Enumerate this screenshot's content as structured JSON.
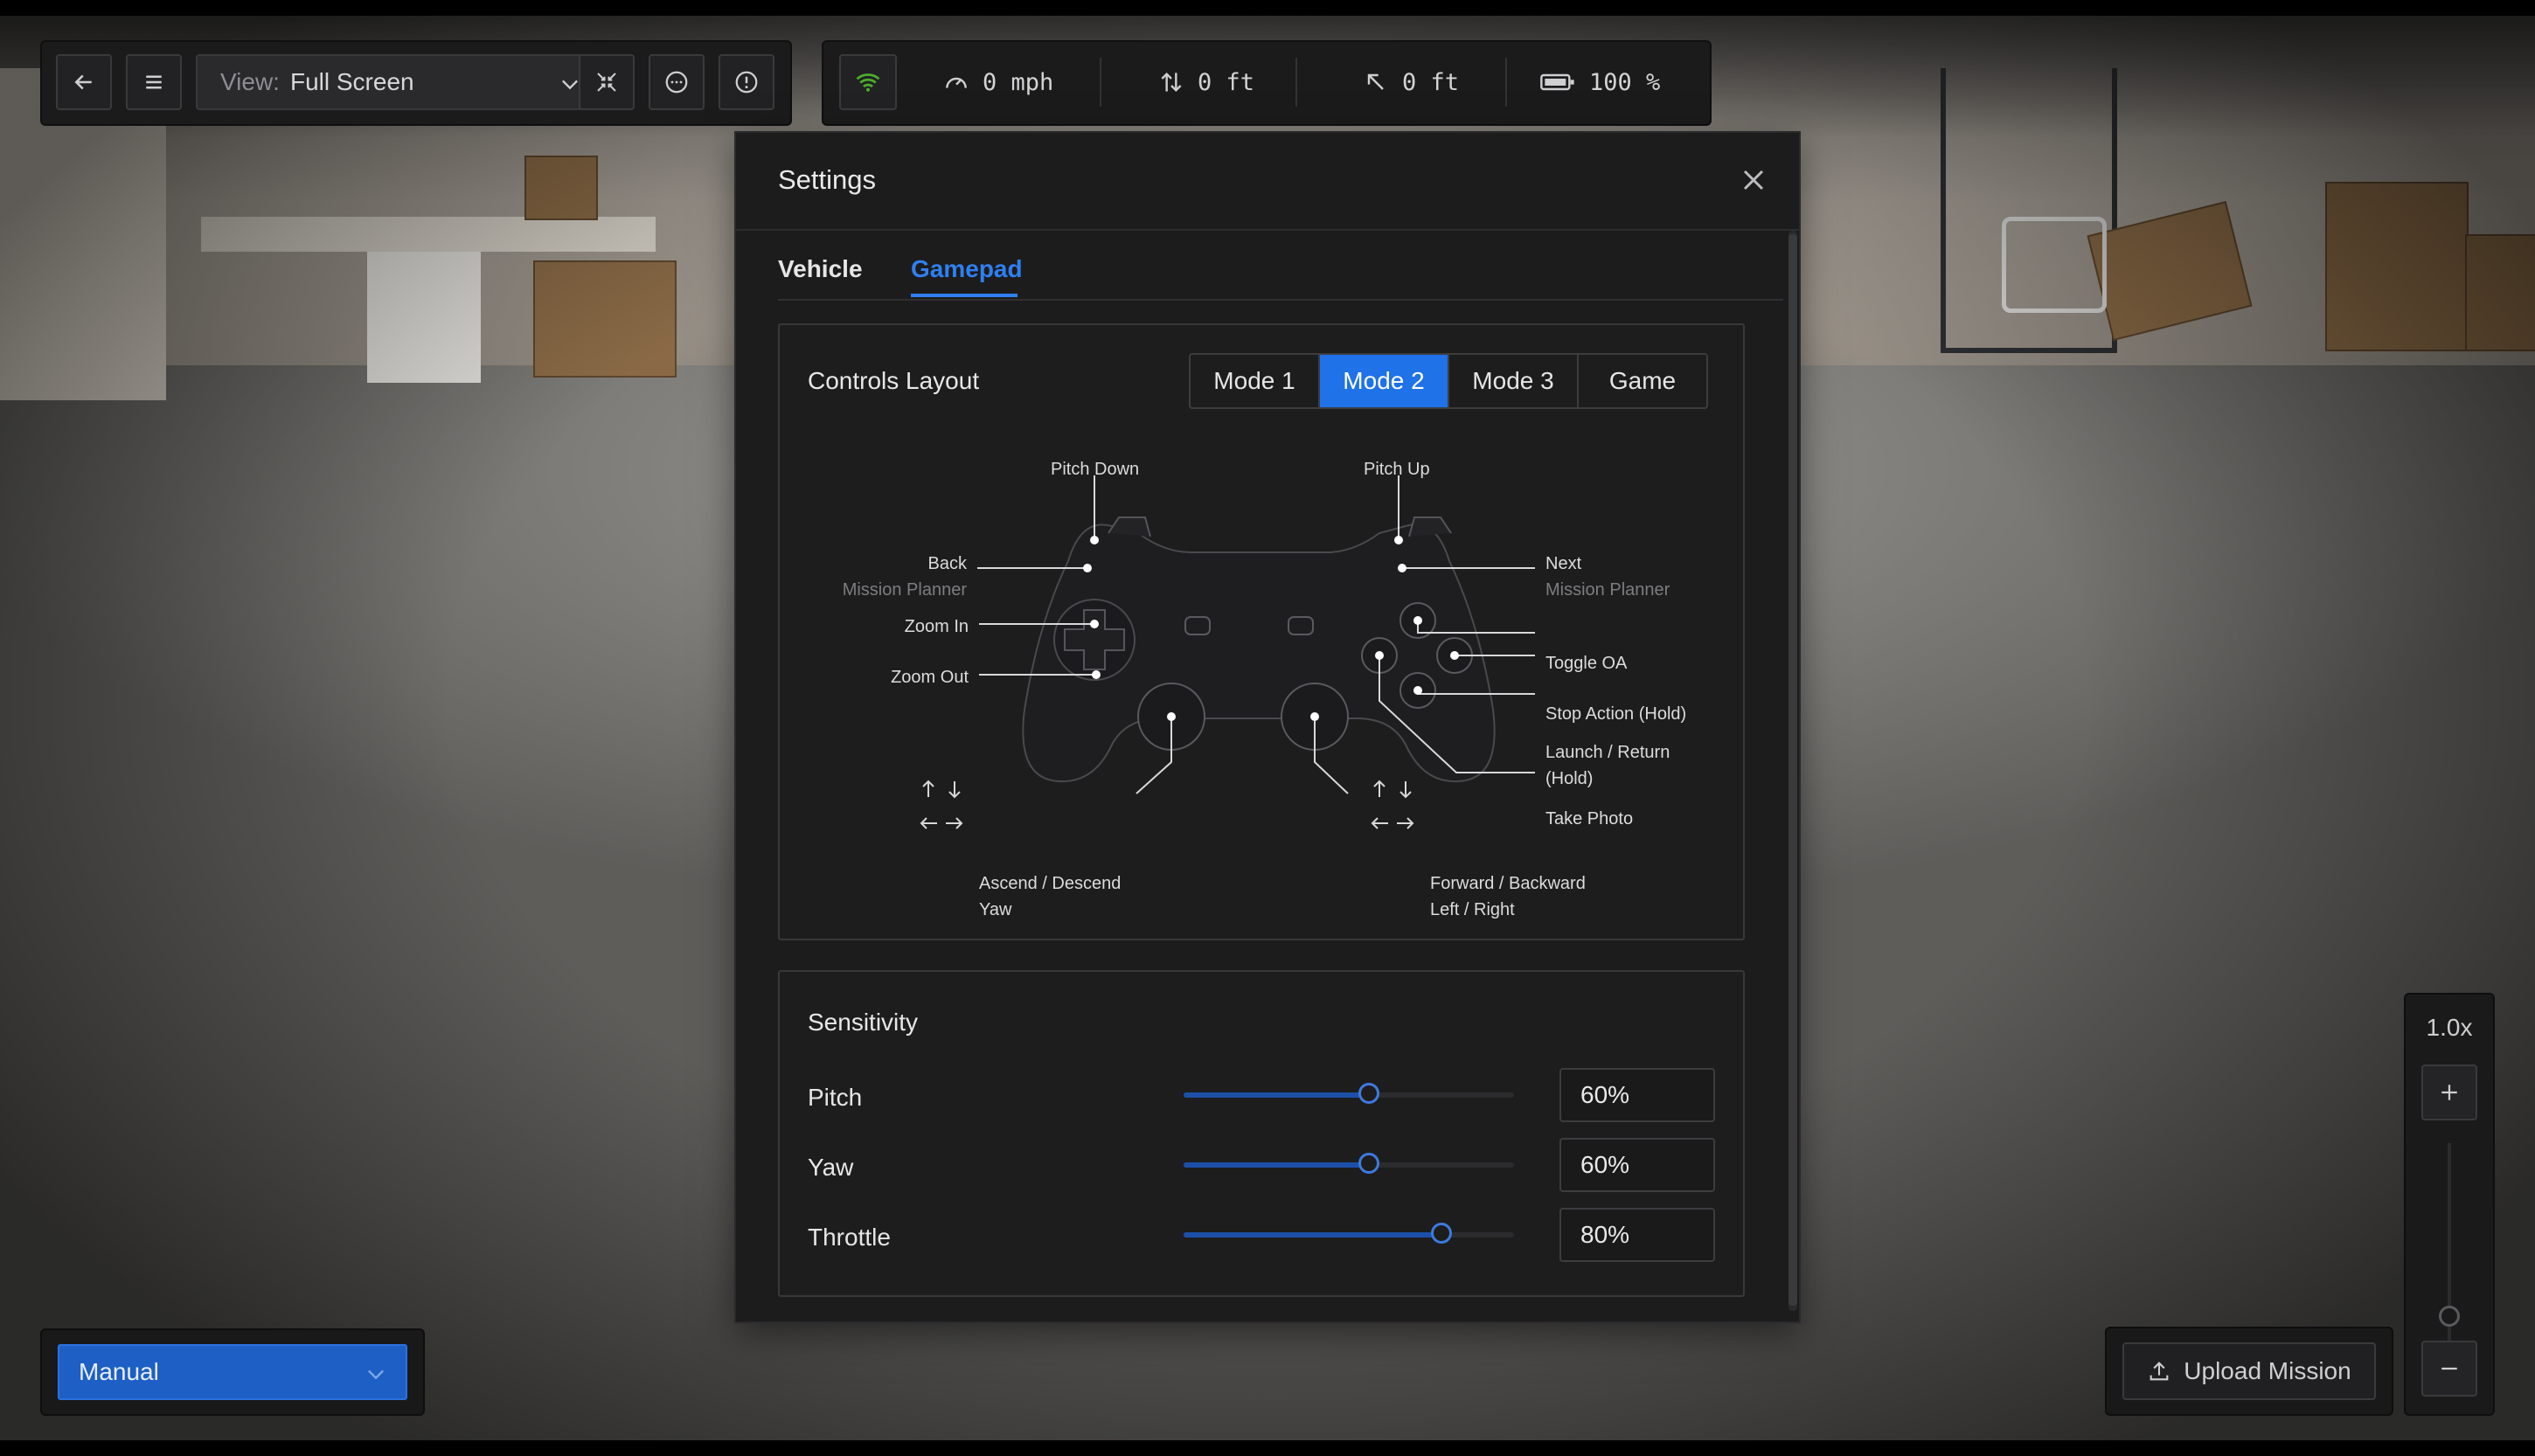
{
  "toolbar": {
    "view_label": "View:",
    "view_value": "Full Screen"
  },
  "telemetry": {
    "speed": "0 mph",
    "altitude": "0 ft",
    "distance": "0 ft",
    "battery": "100 %",
    "signal_color": "#4caf2a"
  },
  "settings": {
    "title": "Settings",
    "tabs": [
      {
        "label": "Vehicle",
        "active": false
      },
      {
        "label": "Gamepad",
        "active": true
      }
    ],
    "controls_layout": {
      "title": "Controls Layout",
      "modes": [
        "Mode 1",
        "Mode 2",
        "Mode 3",
        "Game"
      ],
      "selected_mode": "Mode 2",
      "labels": {
        "pitch_down": "Pitch Down",
        "pitch_up": "Pitch Up",
        "back": "Back",
        "back_sub": "Mission Planner",
        "next": "Next",
        "next_sub": "Mission Planner",
        "zoom_in": "Zoom In",
        "zoom_out": "Zoom Out",
        "toggle_oa": "Toggle OA",
        "stop_action": "Stop Action (Hold)",
        "launch_return": "Launch / Return",
        "launch_return_sub": "(Hold)",
        "take_photo": "Take Photo",
        "ascend_descend": "Ascend / Descend",
        "yaw": "Yaw",
        "forward_backward": "Forward / Backward",
        "left_right": "Left / Right"
      }
    },
    "sensitivity": {
      "title": "Sensitivity",
      "rows": [
        {
          "label": "Pitch",
          "value": "60%",
          "level": 0.56
        },
        {
          "label": "Yaw",
          "value": "60%",
          "level": 0.56
        },
        {
          "label": "Throttle",
          "value": "80%",
          "level": 0.78
        }
      ]
    }
  },
  "flight_mode": {
    "value": "Manual"
  },
  "upload_mission": {
    "label": "Upload Mission"
  },
  "zoom": {
    "level_text": "1.0x"
  },
  "colors": {
    "accent": "#1f72e8",
    "tab_active": "#2f7ff0",
    "panel": "#1c1c1d"
  }
}
